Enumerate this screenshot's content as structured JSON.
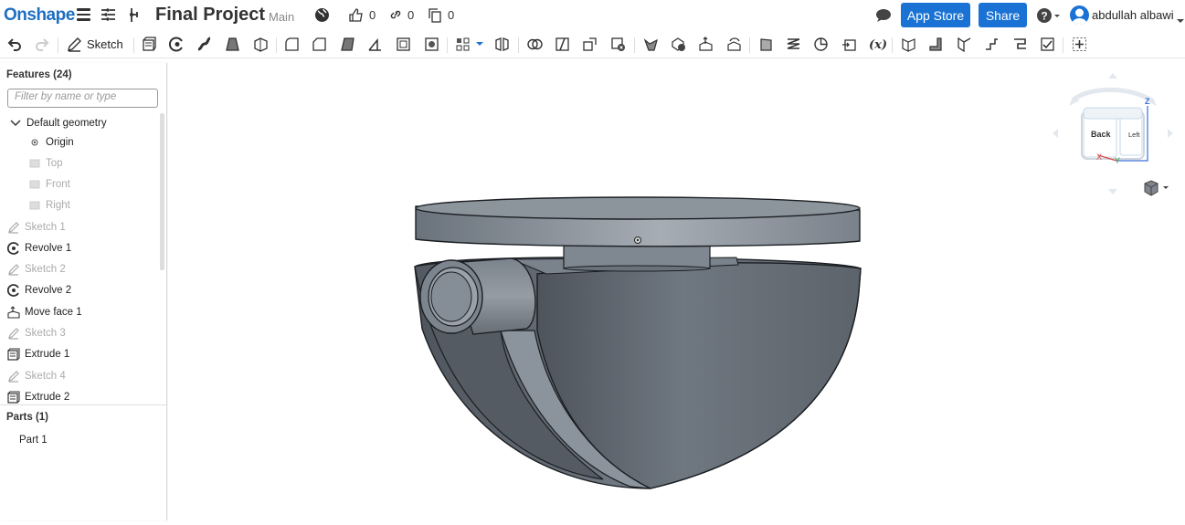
{
  "app": {
    "logo": "Onshape",
    "document_title": "Final Project",
    "branch": "Main"
  },
  "header": {
    "likes": "0",
    "links": "0",
    "copies": "0",
    "app_store_label": "App Store",
    "share_label": "Share",
    "user_name": "abdullah albawi",
    "accent_color": "#1a73d4"
  },
  "toolbar": {
    "sketch_label": "Sketch"
  },
  "panel": {
    "features_header": "Features (24)",
    "filter_placeholder": "Filter by name or type",
    "features": [
      {
        "label": "Default geometry",
        "icon": "chevron-down-icon",
        "muted": false
      },
      {
        "label": "Origin",
        "icon": "origin-icon",
        "muted": false
      },
      {
        "label": "Top",
        "icon": "plane-icon",
        "muted": true
      },
      {
        "label": "Front",
        "icon": "plane-icon",
        "muted": true
      },
      {
        "label": "Right",
        "icon": "plane-icon",
        "muted": true
      },
      {
        "label": "Sketch 1",
        "icon": "pencil-icon",
        "muted": true
      },
      {
        "label": "Revolve 1",
        "icon": "revolve-icon",
        "muted": false
      },
      {
        "label": "Sketch 2",
        "icon": "pencil-icon",
        "muted": true
      },
      {
        "label": "Revolve 2",
        "icon": "revolve-icon",
        "muted": false
      },
      {
        "label": "Move face 1",
        "icon": "move-face-icon",
        "muted": false
      },
      {
        "label": "Sketch 3",
        "icon": "pencil-icon",
        "muted": true
      },
      {
        "label": "Extrude 1",
        "icon": "extrude-icon",
        "muted": false
      },
      {
        "label": "Sketch 4",
        "icon": "pencil-icon",
        "muted": true
      },
      {
        "label": "Extrude 2",
        "icon": "extrude-icon",
        "muted": false
      }
    ],
    "parts_header": "Parts (1)",
    "parts": [
      {
        "label": "Part 1"
      }
    ]
  },
  "viewcube": {
    "front_label": "Back",
    "side_label": "Left",
    "axis_x": "X",
    "axis_y": "Y",
    "axis_z": "Z"
  }
}
